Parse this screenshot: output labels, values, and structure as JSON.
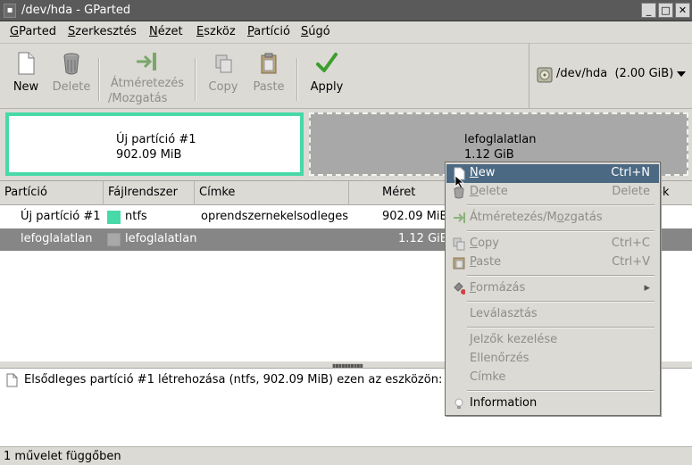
{
  "window": {
    "title": "/dev/hda - GParted"
  },
  "menu": [
    {
      "pre": "",
      "u": "G",
      "post": "Parted"
    },
    {
      "pre": "",
      "u": "S",
      "post": "zerkesztés"
    },
    {
      "pre": "",
      "u": "N",
      "post": "ézet"
    },
    {
      "pre": "",
      "u": "E",
      "post": "szköz"
    },
    {
      "pre": "",
      "u": "P",
      "post": "artíció"
    },
    {
      "pre": "",
      "u": "S",
      "post": "úgó"
    }
  ],
  "toolbar": {
    "new": "New",
    "delete": "Delete",
    "resize_line1": "Átméretezés",
    "resize_line2": "/Mozgatás",
    "copy": "Copy",
    "paste": "Paste",
    "apply": "Apply"
  },
  "device": {
    "path": "/dev/hda",
    "size": "(2.00 GiB)"
  },
  "map": {
    "p1_name": "Új partíció #1",
    "p1_size": "902.09 MiB",
    "p2_name": "lefoglalatlan",
    "p2_size": "1.12 GiB"
  },
  "table": {
    "headers": [
      "Partíció",
      "Fájlrendszer",
      "Címke",
      "Méret",
      "ók"
    ],
    "rows": [
      {
        "partition": "Új partíció #1",
        "fs": "ntfs",
        "label": "oprendszernekelsodleges",
        "size": "902.09 MiB",
        "fs_color": "#47d9a7"
      },
      {
        "partition": "lefoglalatlan",
        "fs": "lefoglalatlan",
        "label": "",
        "size": "1.12 GiB",
        "fs_color": "#a8a8a8"
      }
    ]
  },
  "ops": {
    "entry": "Elsődleges partíció #1 létrehozása (ntfs, 902.09 MiB) ezen az eszközön: /c"
  },
  "status": {
    "text": "1 művelet függőben"
  },
  "context_menu": {
    "new_u": "N",
    "new_rest": "ew",
    "new_key": "Ctrl+N",
    "delete_u": "D",
    "delete_rest": "elete",
    "delete_key": "Delete",
    "resize_pre": "Átméretezés/M",
    "resize_u": "o",
    "resize_post": "zgatás",
    "copy_u": "C",
    "copy_rest": "opy",
    "copy_key": "Ctrl+C",
    "paste_u": "P",
    "paste_rest": "aste",
    "paste_key": "Ctrl+V",
    "format_u": "F",
    "format_rest": "ormázás",
    "unmount": "Leválasztás",
    "flags": "Jelzők kezelése",
    "check": "Ellenőrzés",
    "label": "Címke",
    "info": "Information"
  },
  "colors": {
    "ntfs": "#47d9a7",
    "unallocated": "#a8a8a8",
    "selection": "#4b6983"
  }
}
